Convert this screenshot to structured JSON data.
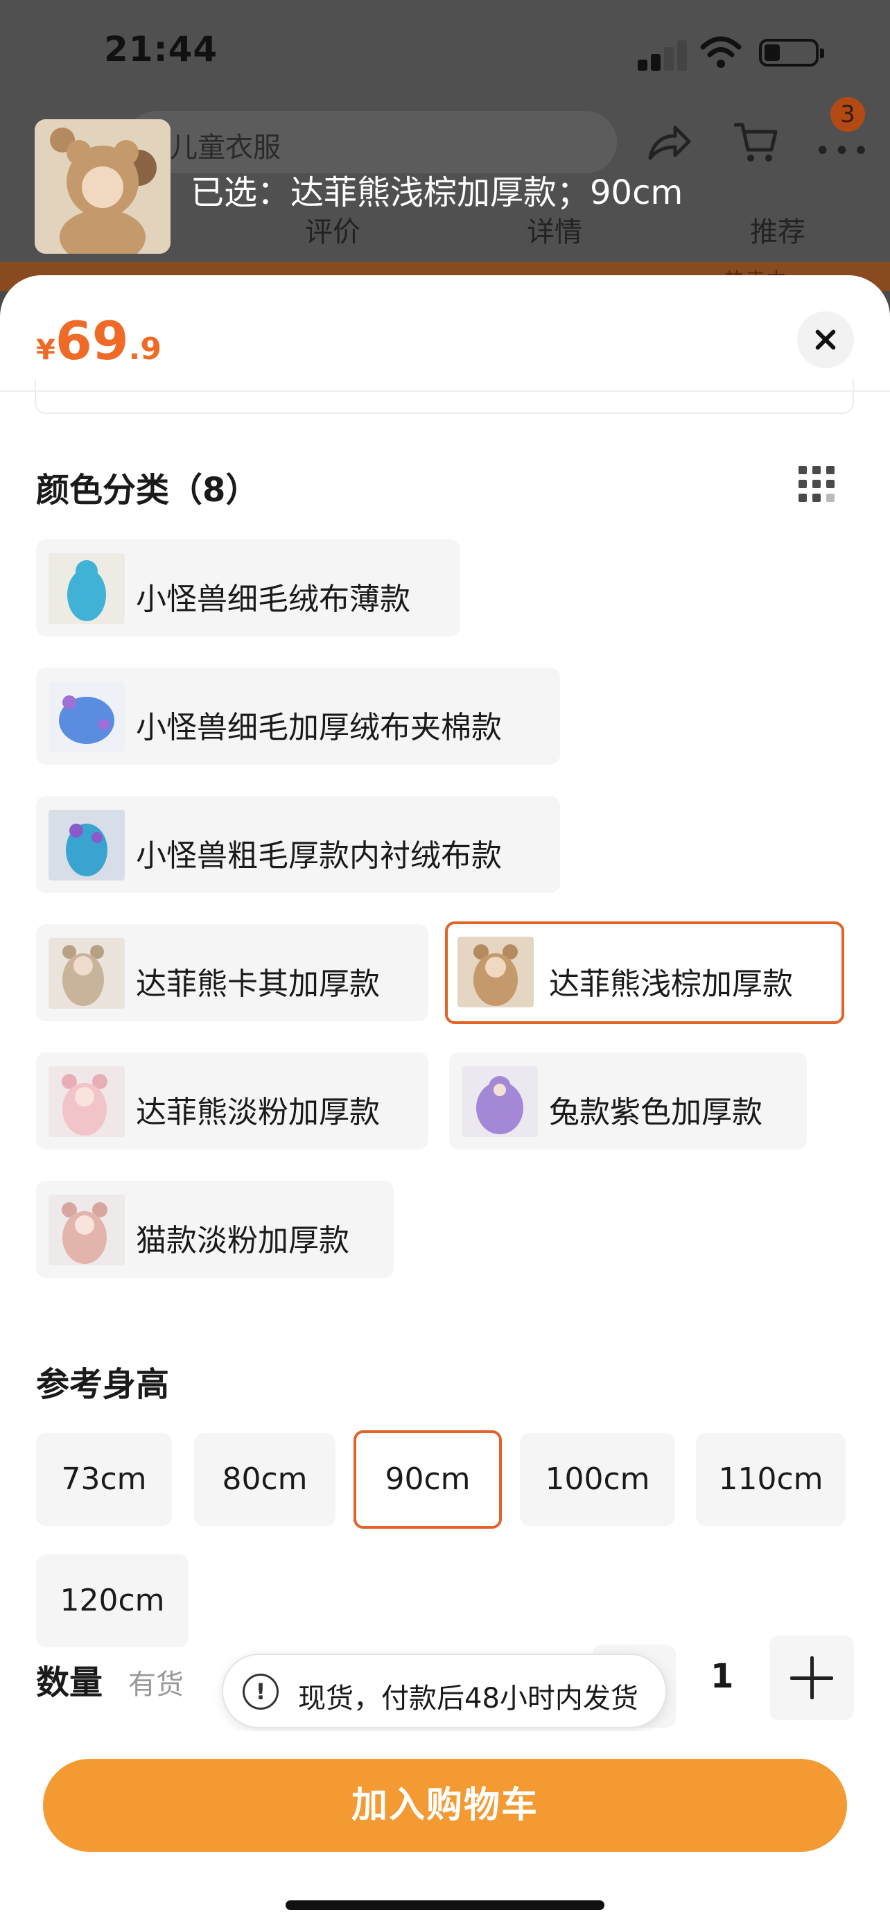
{
  "status_bar": {
    "time": "21:44"
  },
  "background_page": {
    "search_text": "儿童衣服",
    "cart_badge": "3",
    "tabs": [
      "评价",
      "详情",
      "推荐"
    ],
    "banner_text": "热卖中"
  },
  "selection_summary": {
    "text": "已选：达菲熊浅棕加厚款；90cm"
  },
  "price": {
    "currency": "¥",
    "integer": "69",
    "decimal": ".9"
  },
  "color_section": {
    "title": "颜色分类（8）",
    "options": [
      {
        "label": "小怪兽细毛绒布薄款",
        "selected": false
      },
      {
        "label": "小怪兽细毛加厚绒布夹棉款",
        "selected": false
      },
      {
        "label": "小怪兽粗毛厚款内衬绒布款",
        "selected": false
      },
      {
        "label": "达菲熊卡其加厚款",
        "selected": false
      },
      {
        "label": "达菲熊浅棕加厚款",
        "selected": true
      },
      {
        "label": "达菲熊淡粉加厚款",
        "selected": false
      },
      {
        "label": "兔款紫色加厚款",
        "selected": false
      },
      {
        "label": "猫款淡粉加厚款",
        "selected": false
      }
    ]
  },
  "size_section": {
    "title": "参考身高",
    "options": [
      {
        "label": "73cm",
        "selected": false
      },
      {
        "label": "80cm",
        "selected": false
      },
      {
        "label": "90cm",
        "selected": true
      },
      {
        "label": "100cm",
        "selected": false
      },
      {
        "label": "110cm",
        "selected": false
      },
      {
        "label": "120cm",
        "selected": false
      }
    ]
  },
  "quantity": {
    "title": "数量",
    "stock": "有货",
    "value": "1"
  },
  "toast": {
    "icon": "!",
    "text": "现货，付款后48小时内发货"
  },
  "add_to_cart": {
    "label": "加入购物车"
  },
  "colors": {
    "accent": "#ef6a26",
    "button": "#f39a33",
    "selected_border": "#e2622a"
  }
}
